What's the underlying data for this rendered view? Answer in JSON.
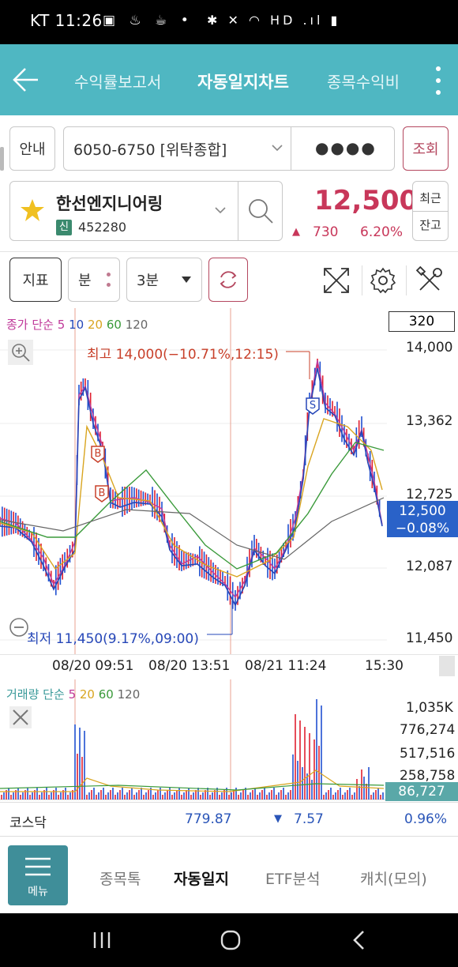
{
  "status_bar": {
    "time": "KT 11:26",
    "left_icons": "▣ ♨ ☕ •",
    "right_icons": "✱ ✕ ◠ HD .ıl ▮"
  },
  "header": {
    "tabs": [
      {
        "label": "수익률보고서"
      },
      {
        "label": "자동일지차트"
      },
      {
        "label": "종목수익비"
      }
    ]
  },
  "controls": {
    "guide_label": "안내",
    "account": "6050-6750 [위탁종합]",
    "password_mask": "●●●●",
    "query_label": "조회",
    "stock_name": "한선엔지니어링",
    "stock_badge": "신",
    "stock_code": "452280",
    "price": "12,500",
    "change": "730",
    "change_pct": "6.20%",
    "recent_label": "최근",
    "balance_label": "잔고",
    "indicator_label": "지표",
    "unit_label": "분",
    "interval_value": "3분"
  },
  "chart": {
    "legend_price_prefix": "종가 단순",
    "legend_ma": [
      "5",
      "10",
      "20",
      "60",
      "120"
    ],
    "bar_count": "320",
    "high_label": "최고 14,000(−10.71%,12:15)",
    "low_label": "최저 11,450(9.17%,09:00)",
    "y_ticks": [
      "14,000",
      "13,362",
      "12,725",
      "12,087",
      "11,450"
    ],
    "current_price": "12,500",
    "current_pct": "−0.08%",
    "x_ticks": [
      "08/20 09:51",
      "08/20 13:51",
      "08/21 11:24",
      "15:30"
    ],
    "volume_legend_prefix": "거래량 단순",
    "volume_ma": [
      "5",
      "20",
      "60",
      "120"
    ],
    "volume_ticks": [
      "1,035K",
      "776,274",
      "517,516",
      "258,758"
    ],
    "volume_current": "86,727",
    "colors": {
      "ma5": "#c0399a",
      "ma10": "#2647b8",
      "ma20": "#d9a520",
      "ma60": "#3a9a3a",
      "ma120": "#666666",
      "up": "#e02030",
      "down": "#2050d0"
    }
  },
  "kosdaq": {
    "name": "코스닥",
    "value": "779.87",
    "change": "7.57",
    "pct": "0.96%"
  },
  "bottom_nav": {
    "menu_label": "메뉴",
    "tabs": [
      {
        "label": "종목톡"
      },
      {
        "label": "자동일지"
      },
      {
        "label": "ETF분석"
      },
      {
        "label": "캐치(모의)"
      }
    ]
  }
}
